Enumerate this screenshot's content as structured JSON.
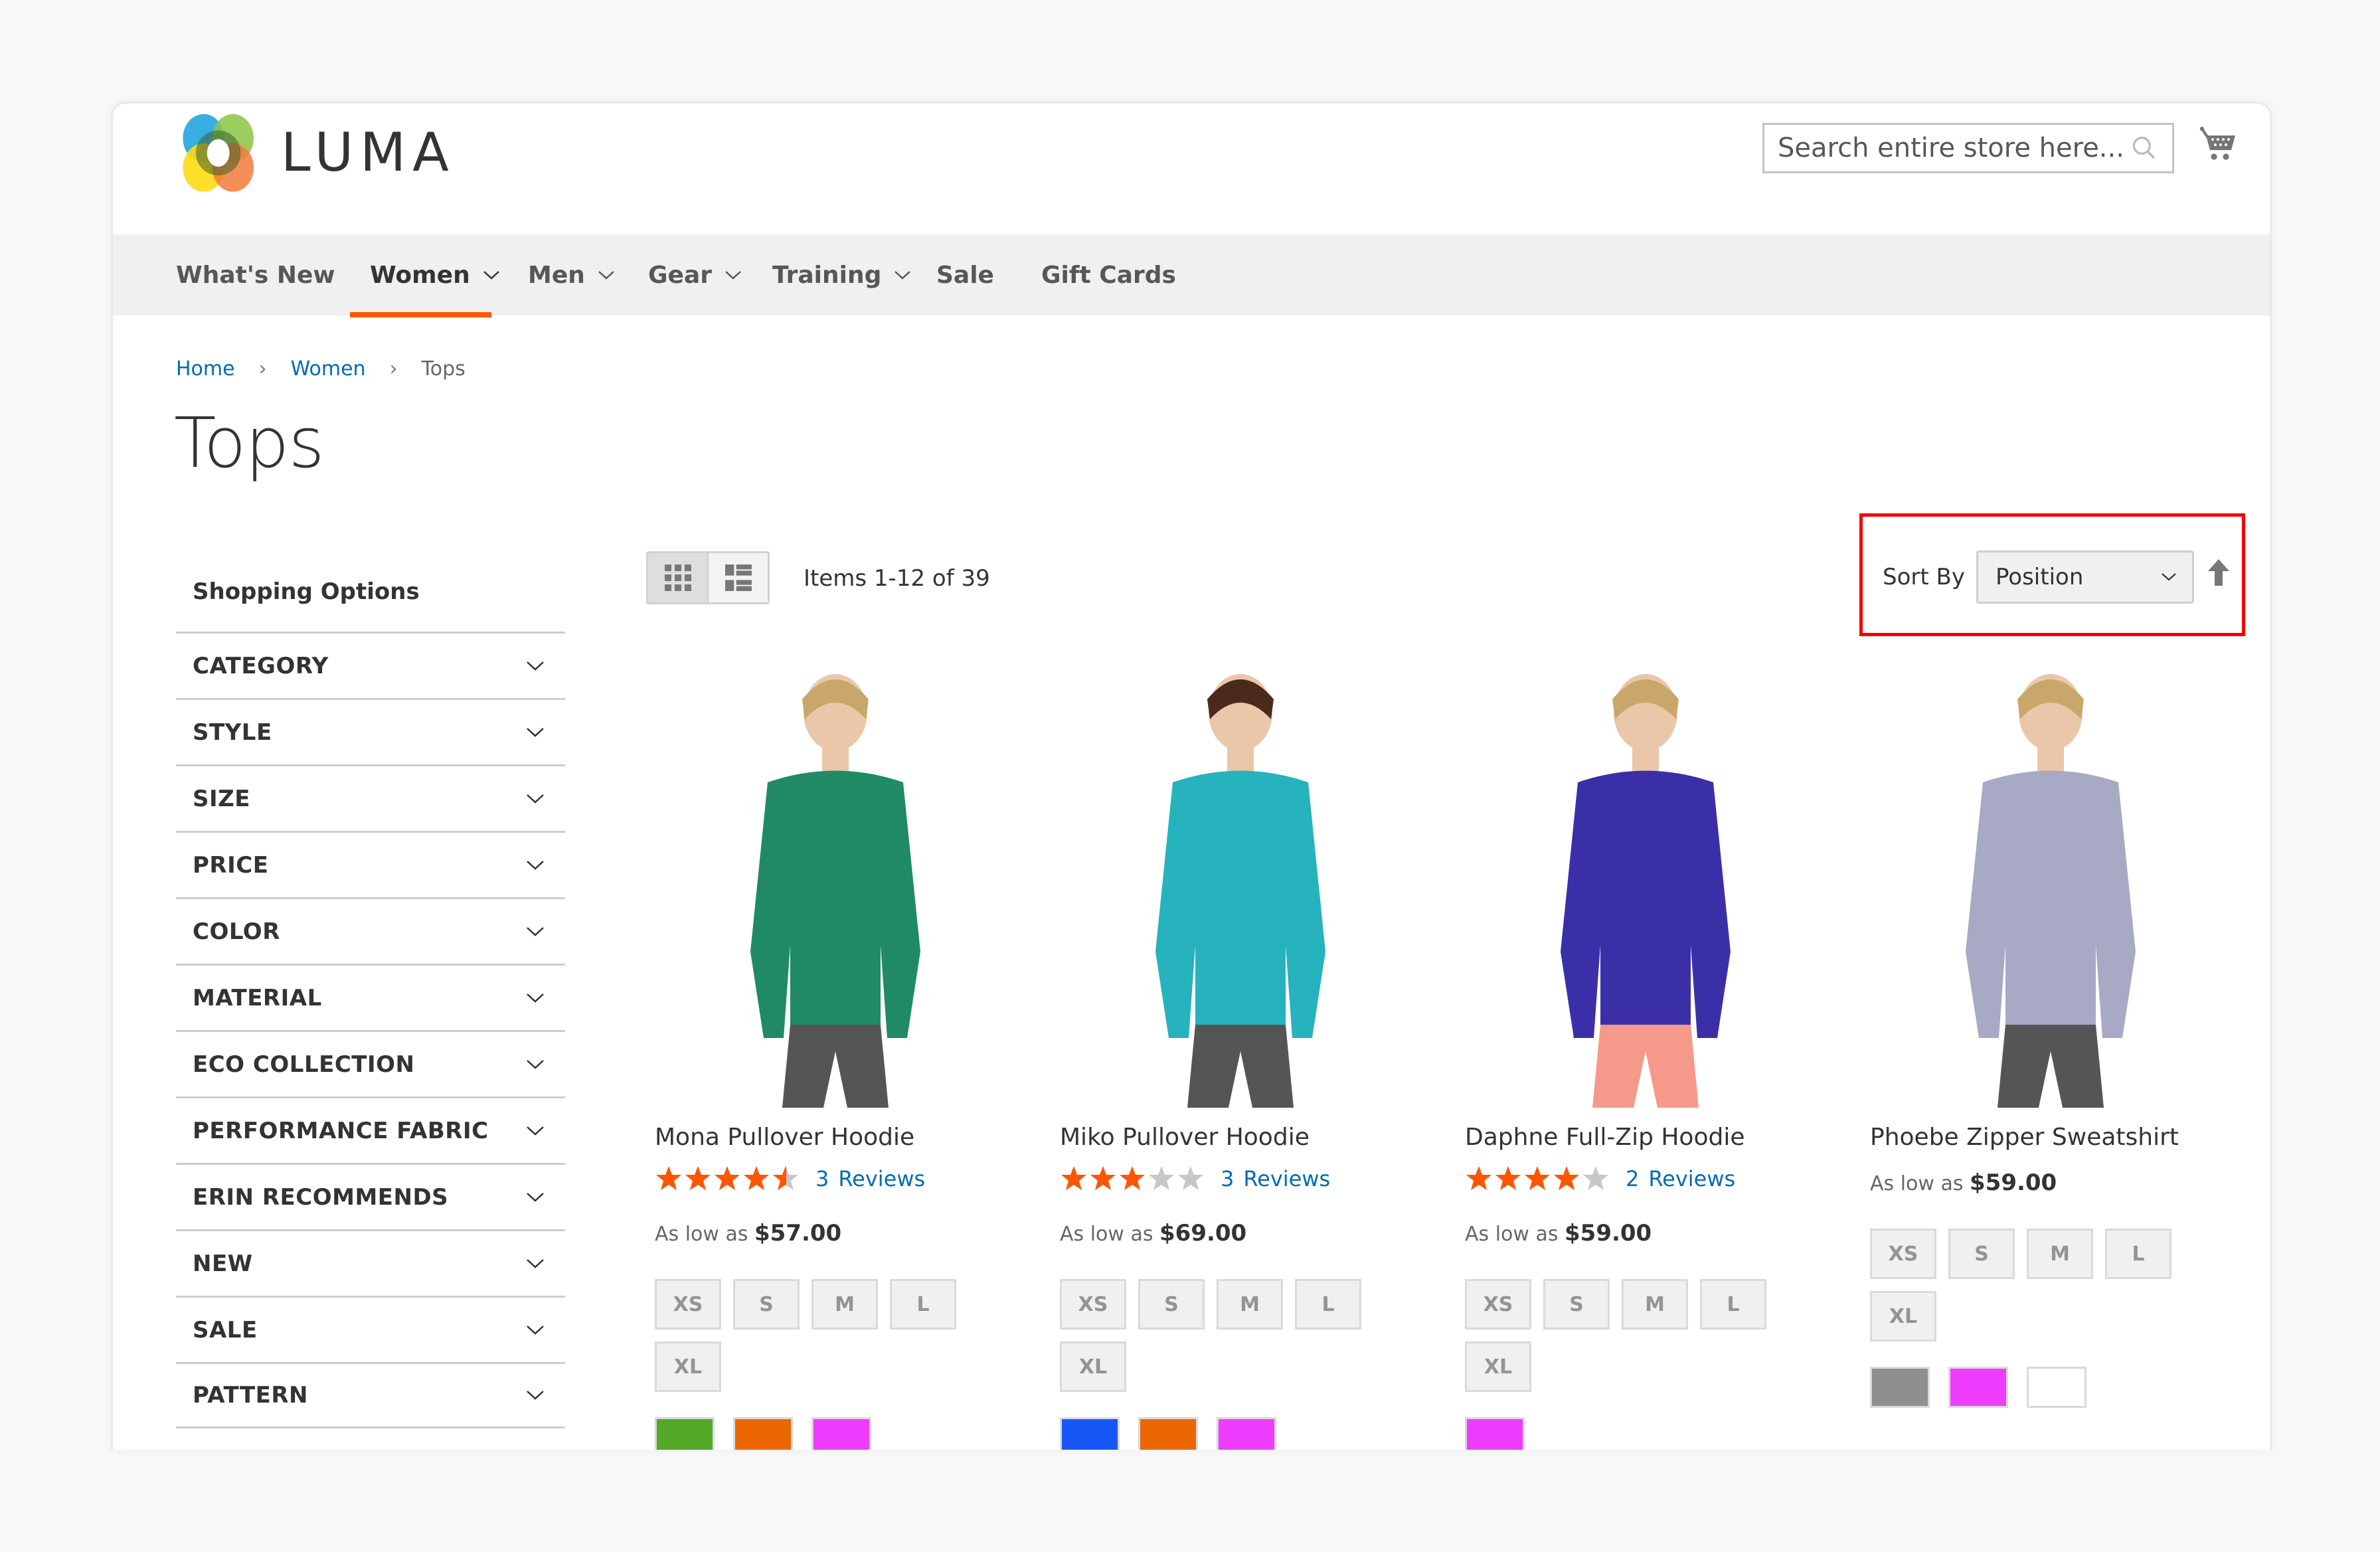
{
  "header": {
    "logo_text": "LUMA",
    "search_placeholder": "Search entire store here...",
    "search_icon": "search-icon",
    "cart_icon": "cart-icon"
  },
  "nav": {
    "items": [
      {
        "label": "What's New",
        "has_dropdown": false
      },
      {
        "label": "Women",
        "has_dropdown": true,
        "active": true
      },
      {
        "label": "Men",
        "has_dropdown": true
      },
      {
        "label": "Gear",
        "has_dropdown": true
      },
      {
        "label": "Training",
        "has_dropdown": true
      },
      {
        "label": "Sale",
        "has_dropdown": false
      },
      {
        "label": "Gift Cards",
        "has_dropdown": false
      }
    ],
    "accent_color": "#ff5501"
  },
  "breadcrumb": {
    "items": [
      {
        "label": "Home",
        "link": true
      },
      {
        "label": "Women",
        "link": true
      },
      {
        "label": "Tops",
        "link": false
      }
    ],
    "separator": "›"
  },
  "page_title": "Tops",
  "sidebar": {
    "title": "Shopping Options",
    "filters": [
      "CATEGORY",
      "STYLE",
      "SIZE",
      "PRICE",
      "COLOR",
      "MATERIAL",
      "ECO COLLECTION",
      "PERFORMANCE FABRIC",
      "ERIN RECOMMENDS",
      "NEW",
      "SALE",
      "PATTERN"
    ]
  },
  "toolbar": {
    "view_modes": [
      "grid",
      "list"
    ],
    "active_mode": "grid",
    "items_count": "Items 1-12 of 39",
    "sort_label": "Sort By",
    "sort_value": "Position",
    "sort_direction": "ascending",
    "highlight_color": "#f30000"
  },
  "products": [
    {
      "name": "Mona Pullover Hoodie",
      "rating_percent": 90,
      "review_count": "3",
      "reviews_label": "Reviews",
      "price_prefix": "As low as",
      "price": "$57.00",
      "sizes": [
        "XS",
        "S",
        "M",
        "L",
        "XL"
      ],
      "colors": [
        "#53a828",
        "#eb6703",
        "#ef3dff"
      ],
      "garment_color": "#1f8a63"
    },
    {
      "name": "Miko Pullover Hoodie",
      "rating_percent": 60,
      "review_count": "3",
      "reviews_label": "Reviews",
      "price_prefix": "As low as",
      "price": "$69.00",
      "sizes": [
        "XS",
        "S",
        "M",
        "L",
        "XL"
      ],
      "colors": [
        "#1857f7",
        "#eb6703",
        "#ef3dff"
      ],
      "garment_color": "#26b3bd"
    },
    {
      "name": "Daphne Full-Zip Hoodie",
      "rating_percent": 80,
      "review_count": "2",
      "reviews_label": "Reviews",
      "price_prefix": "As low as",
      "price": "$59.00",
      "sizes": [
        "XS",
        "S",
        "M",
        "L",
        "XL"
      ],
      "colors": [
        "#ef3dff"
      ],
      "garment_color": "#3b2fa8"
    },
    {
      "name": "Phoebe Zipper Sweatshirt",
      "rating_percent": null,
      "review_count": null,
      "reviews_label": null,
      "price_prefix": "As low as",
      "price": "$59.00",
      "sizes": [
        "XS",
        "S",
        "M",
        "L",
        "XL"
      ],
      "colors": [
        "#8f8f8f",
        "#ef3dff",
        "#ffffff"
      ],
      "garment_color": "#a8a9c4"
    }
  ]
}
